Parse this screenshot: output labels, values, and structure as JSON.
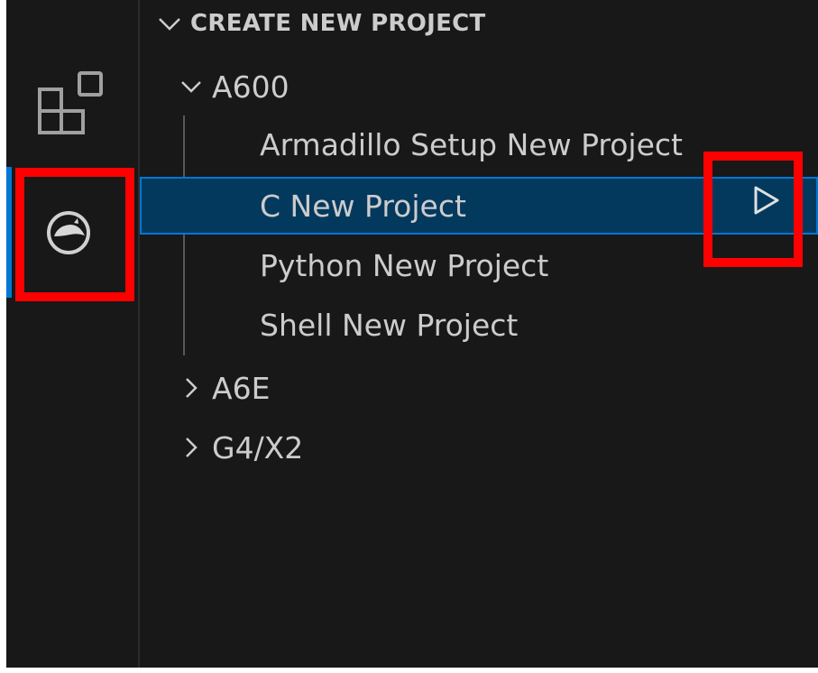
{
  "activity_bar": {
    "icons": [
      {
        "name": "extensions-icon"
      },
      {
        "name": "armadillo-icon"
      }
    ]
  },
  "sidebar": {
    "section_title": "CREATE NEW PROJECT",
    "tree": [
      {
        "label": "A600",
        "expanded": true,
        "children": [
          {
            "label": "Armadillo Setup New Project"
          },
          {
            "label": "C New Project",
            "selected": true
          },
          {
            "label": "Python New Project"
          },
          {
            "label": "Shell New Project"
          }
        ]
      },
      {
        "label": "A6E",
        "expanded": false
      },
      {
        "label": "G4/X2",
        "expanded": false
      }
    ]
  },
  "colors": {
    "background": "#181818",
    "selection": "#04395e",
    "focus_border": "#0078d4",
    "highlight": "#ff0000",
    "text": "#cccccc"
  }
}
